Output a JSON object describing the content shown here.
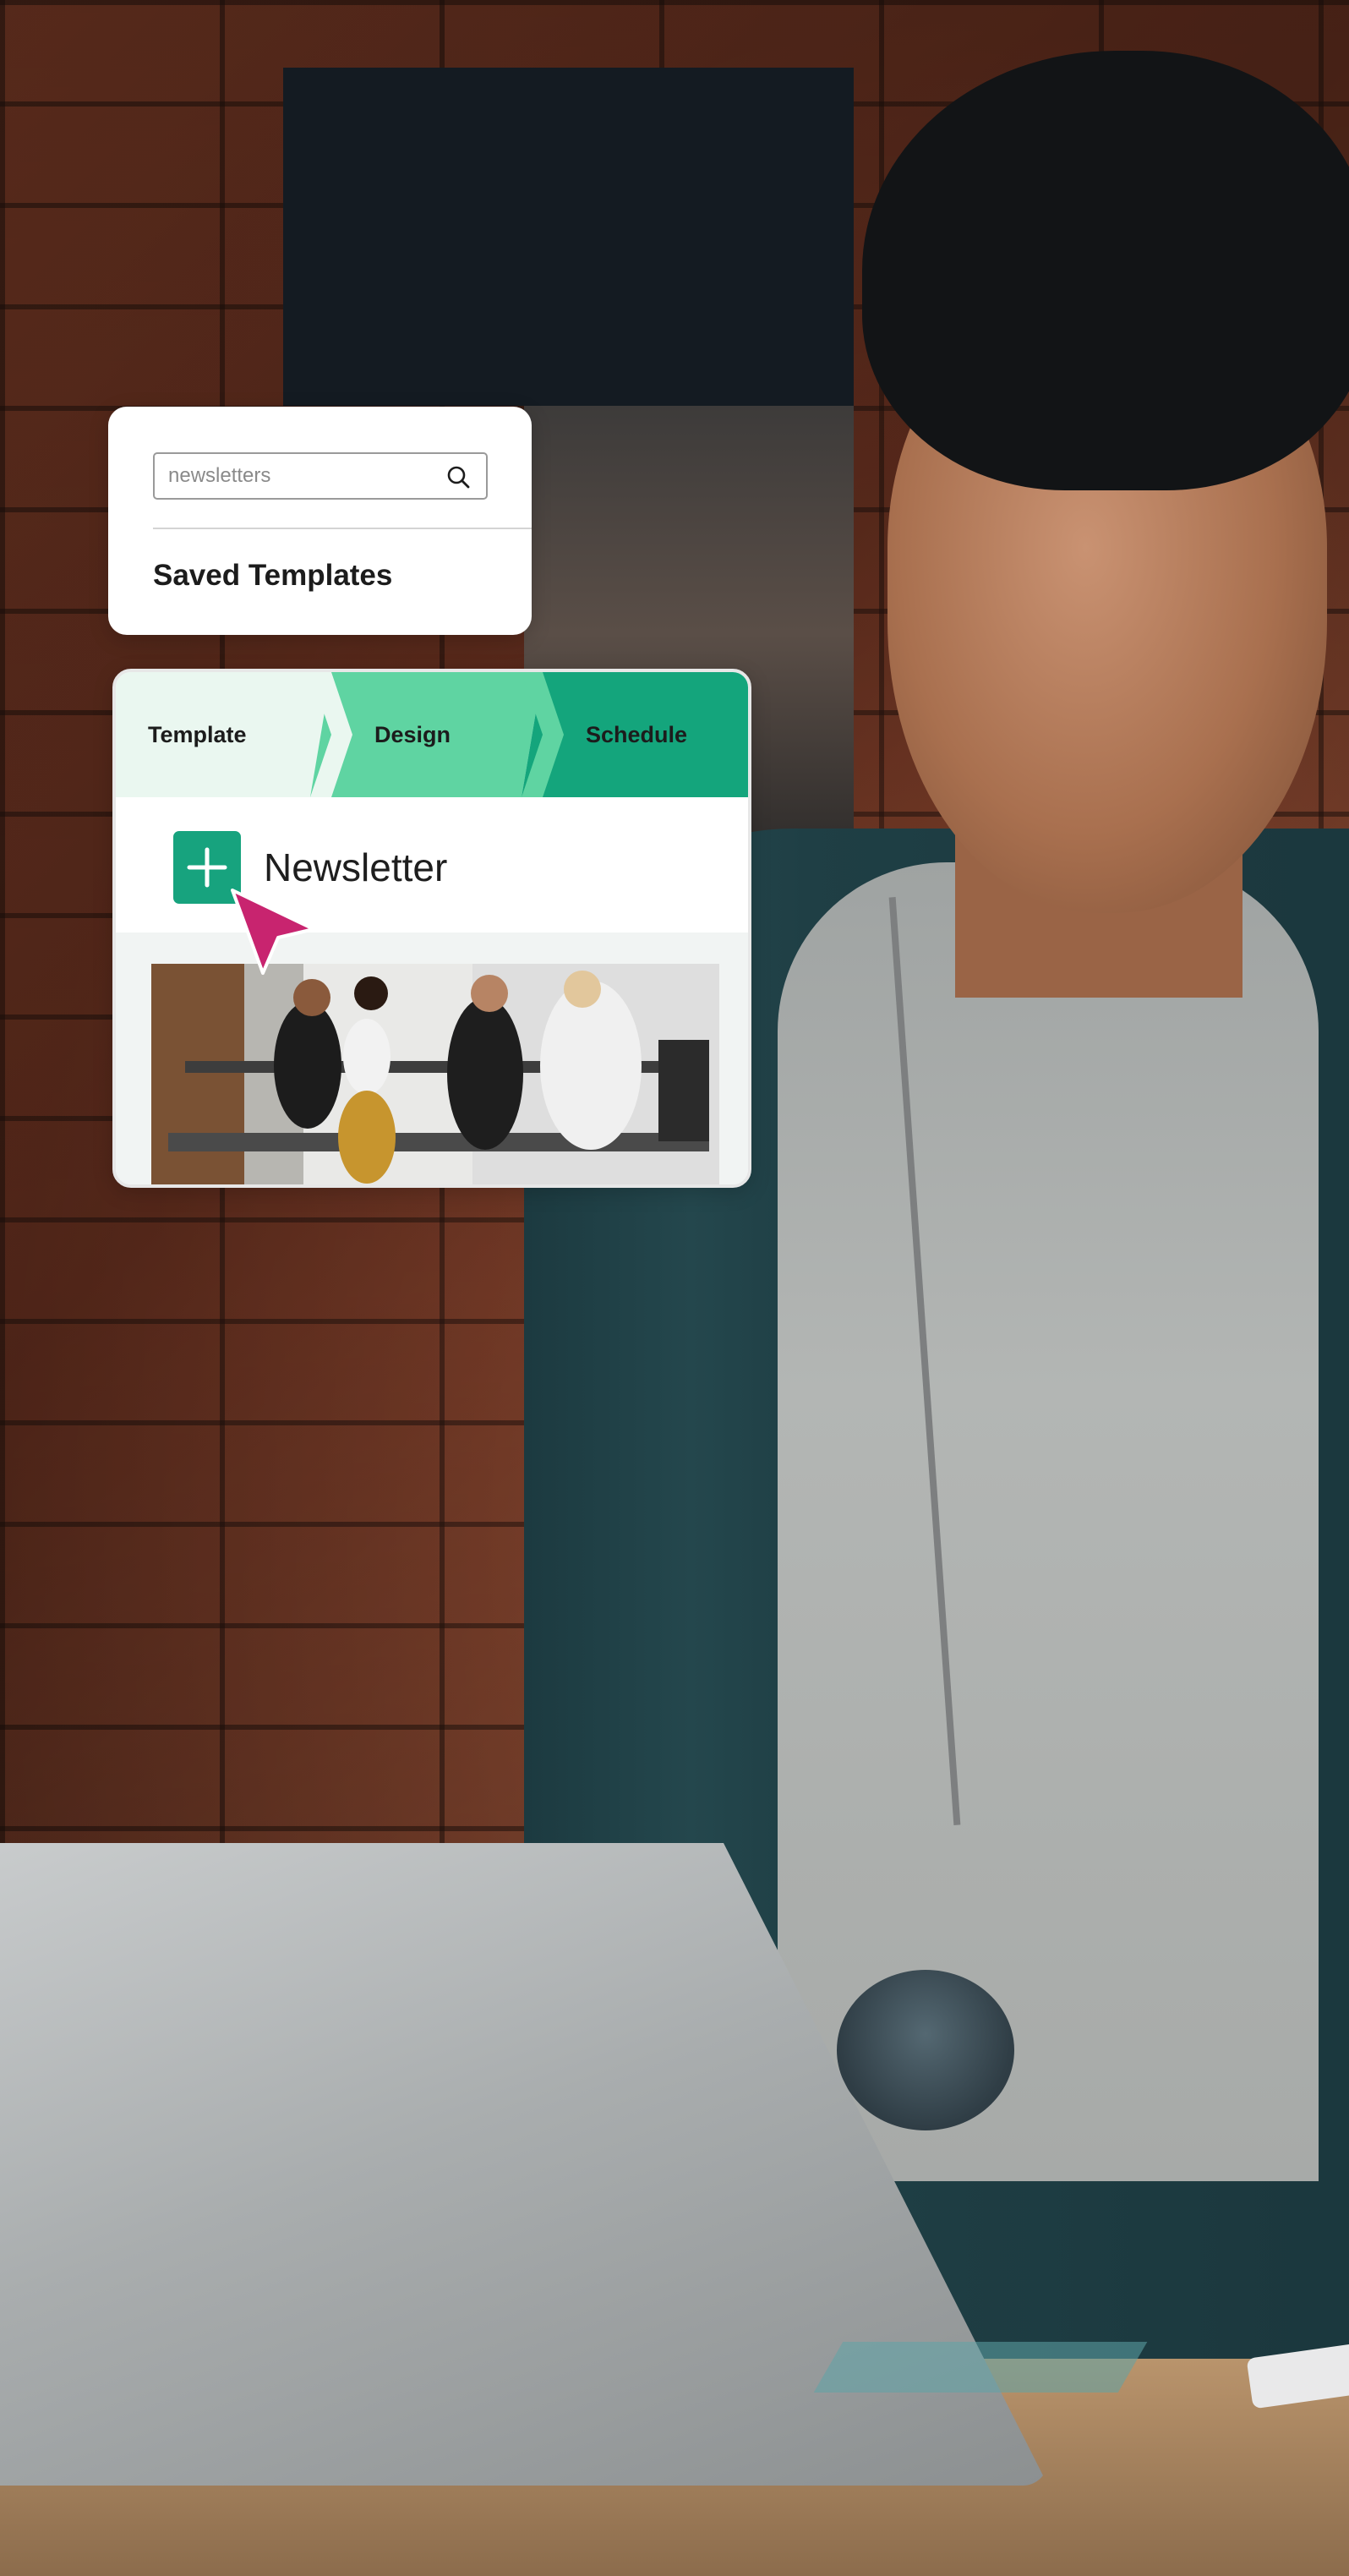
{
  "search_card": {
    "search_placeholder": "newsletters",
    "search_icon": "search-icon",
    "section_title": "Saved Templates"
  },
  "newsletter_card": {
    "steps": [
      {
        "label": "Template",
        "color": "#eaf7f0"
      },
      {
        "label": "Design",
        "color": "#5fd4a2"
      },
      {
        "label": "Schedule",
        "color": "#14a57c"
      }
    ],
    "add_icon": "plus-icon",
    "title": "Newsletter",
    "cursor_icon": "pointer-cursor-icon",
    "image_alt": "people running on treadmills"
  },
  "colors": {
    "accent_green": "#17a37e",
    "cursor_pink": "#c8246f"
  }
}
